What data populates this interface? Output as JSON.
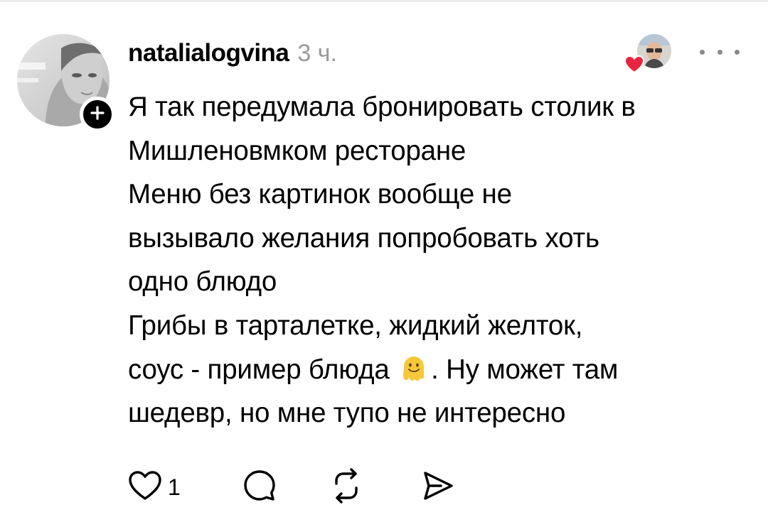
{
  "comment": {
    "username": "natalialogvina",
    "timestamp": "3 ч.",
    "avatar_icon": "user-avatar-photo",
    "follow_icon": "plus-icon",
    "liker_icon": "liker-avatar-photo",
    "liked_heart_color": "#e8253f",
    "body_lines": [
      "Я так передумала бронировать столик в",
      "Мишленовмком ресторане",
      "Меню без картинок вообще не",
      "вызывало желания попробовать хоть",
      "одно блюдо",
      "Грибы в тарталетке, жидкий желток,",
      "соус - пример блюда",
      ". Ну может там",
      "шедевр, но мне тупо не интересно"
    ],
    "emoji": "melting-face-emoji"
  },
  "actions": {
    "like_count": "1",
    "like_icon": "heart-outline-icon",
    "reply_icon": "speech-bubble-icon",
    "repost_icon": "repost-icon",
    "share_icon": "send-icon"
  },
  "more_icon": "more-dots-icon"
}
